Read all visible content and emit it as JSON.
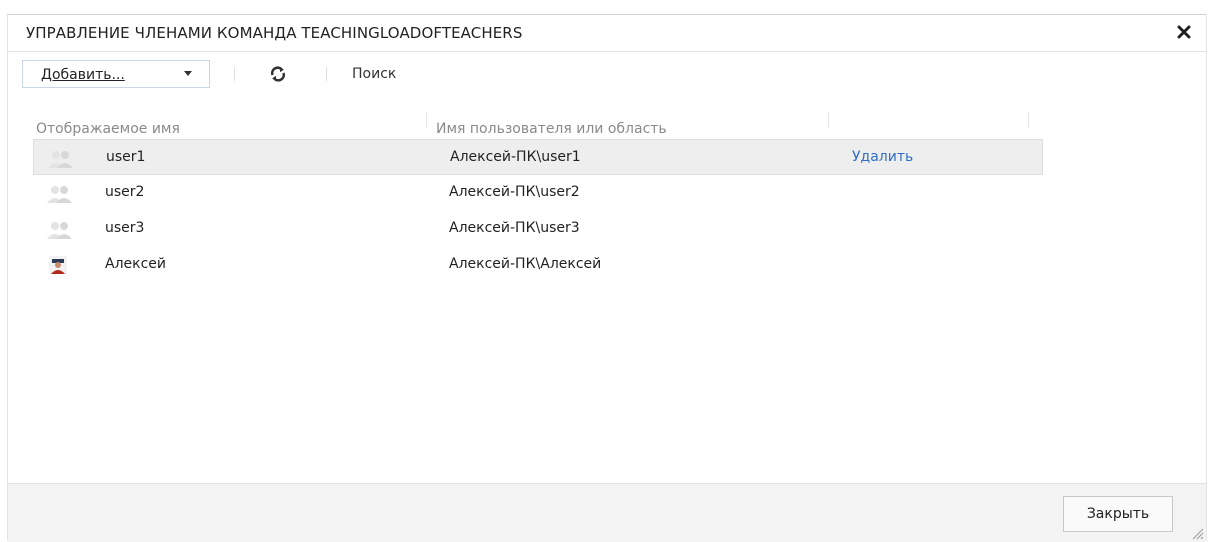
{
  "dialog": {
    "title": "УПРАВЛЕНИЕ ЧЛЕНАМИ КОМАНДА TEACHINGLOADOFTEACHERS",
    "close_icon": "close-icon"
  },
  "toolbar": {
    "add_label": "Добавить...",
    "add_icon": "chevron-down-icon",
    "refresh_icon": "refresh-icon",
    "search_label": "Поиск"
  },
  "table": {
    "headers": {
      "display_name": "Отображаемое имя",
      "user_or_scope": "Имя пользователя или область"
    },
    "rows": [
      {
        "name": "user1",
        "user": "Алексей-ПК\\user1",
        "action": "Удалить",
        "avatar": "user-placeholder-icon",
        "selected": true
      },
      {
        "name": "user2",
        "user": "Алексей-ПК\\user2",
        "action": "",
        "avatar": "user-placeholder-icon",
        "selected": false
      },
      {
        "name": "user3",
        "user": "Алексей-ПК\\user3",
        "action": "",
        "avatar": "user-placeholder-icon",
        "selected": false
      },
      {
        "name": "Алексей",
        "user": "Алексей-ПК\\Алексей",
        "action": "",
        "avatar": "user-photo-icon",
        "selected": false
      }
    ]
  },
  "footer": {
    "close_label": "Закрыть",
    "resize_icon": "resize-grip-icon"
  },
  "colors": {
    "link": "#2f6fc4",
    "selected_row": "#eeeeee",
    "header_text": "#8a8a8a",
    "footer_bg": "#f3f3f3"
  }
}
